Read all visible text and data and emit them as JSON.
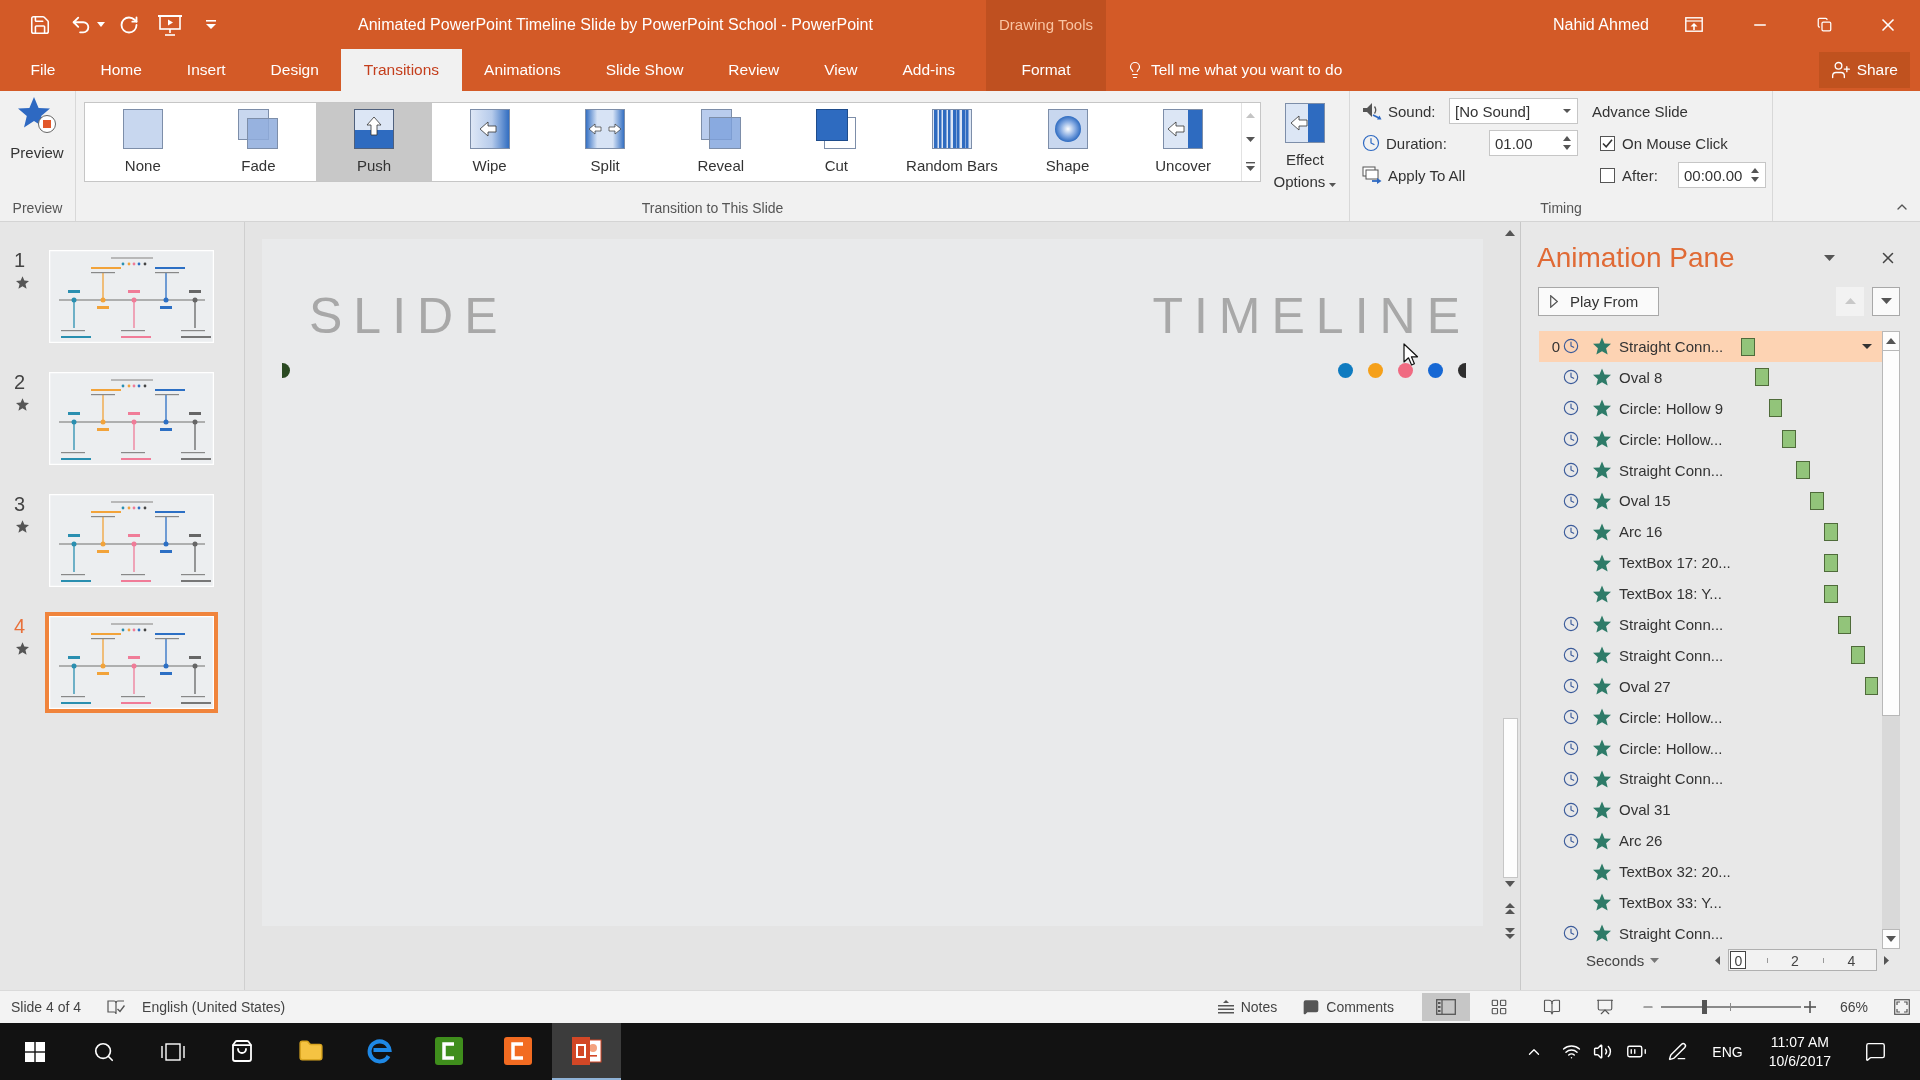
{
  "window": {
    "title": "Animated PowerPoint Timeline Slide by PowerPoint School - PowerPoint",
    "user_name": "Nahid Ahmed"
  },
  "ribbon_tabs": [
    {
      "label": "File",
      "selected": false
    },
    {
      "label": "Home",
      "selected": false
    },
    {
      "label": "Insert",
      "selected": false
    },
    {
      "label": "Design",
      "selected": false
    },
    {
      "label": "Transitions",
      "selected": true
    },
    {
      "label": "Animations",
      "selected": false
    },
    {
      "label": "Slide Show",
      "selected": false
    },
    {
      "label": "Review",
      "selected": false
    },
    {
      "label": "View",
      "selected": false
    },
    {
      "label": "Add-ins",
      "selected": false
    }
  ],
  "contextual_tabs": {
    "group": "Drawing Tools",
    "tabs": [
      {
        "label": "Format",
        "selected": false
      }
    ]
  },
  "tell_me": {
    "placeholder": "Tell me what you want to do"
  },
  "share_button": "Share",
  "ribbon": {
    "preview_group": {
      "button": "Preview",
      "label": "Preview"
    },
    "transition_group": {
      "label": "Transition to This Slide",
      "gallery": [
        {
          "kind": "none",
          "label": "None",
          "selected": false
        },
        {
          "kind": "fade",
          "label": "Fade",
          "selected": false
        },
        {
          "kind": "push",
          "label": "Push",
          "selected": true
        },
        {
          "kind": "wipe",
          "label": "Wipe",
          "selected": false
        },
        {
          "kind": "split",
          "label": "Split",
          "selected": false
        },
        {
          "kind": "reveal",
          "label": "Reveal",
          "selected": false
        },
        {
          "kind": "cut",
          "label": "Cut",
          "selected": false
        },
        {
          "kind": "random-bars",
          "label": "Random Bars",
          "selected": false
        },
        {
          "kind": "shape",
          "label": "Shape",
          "selected": false
        },
        {
          "kind": "uncover",
          "label": "Uncover",
          "selected": false
        }
      ],
      "effect_options": "Effect Options"
    },
    "timing_group": {
      "label": "Timing",
      "sound": {
        "label": "Sound:",
        "value": "[No Sound]"
      },
      "duration": {
        "label": "Duration:",
        "value": "01.00"
      },
      "apply_to_all": "Apply To All",
      "advance_slide": {
        "heading": "Advance Slide",
        "on_mouse_click": {
          "label": "On Mouse Click",
          "checked": true
        },
        "after": {
          "label": "After:",
          "checked": false,
          "value": "00:00.00"
        }
      }
    }
  },
  "slides": [
    {
      "number": "1",
      "selected": false
    },
    {
      "number": "2",
      "selected": false
    },
    {
      "number": "3",
      "selected": false
    },
    {
      "number": "4",
      "selected": true
    }
  ],
  "slide": {
    "title_parts": [
      "SLIDE",
      "TIMELINE"
    ],
    "dots_left": [
      {
        "color": "#2b4a22",
        "clipped": true
      }
    ],
    "dots_right": [
      {
        "color": "#0f7bc0",
        "clipped": false
      },
      {
        "color": "#f5a01a",
        "clipped": false
      },
      {
        "color": "#f06b82",
        "clipped": false
      },
      {
        "color": "#1768d4",
        "clipped": false
      },
      {
        "color": "#2e2e2e",
        "clipped": true
      }
    ]
  },
  "animation_pane": {
    "title": "Animation Pane",
    "play_button": "Play From",
    "items": [
      {
        "index": "0",
        "kind": "after-previous",
        "label": "Straight Conn...",
        "selected": true
      },
      {
        "kind": "after-previous",
        "label": "Oval 8",
        "selected": false
      },
      {
        "kind": "after-previous",
        "label": "Circle: Hollow 9",
        "selected": false
      },
      {
        "kind": "after-previous",
        "label": "Circle: Hollow...",
        "selected": false
      },
      {
        "kind": "after-previous",
        "label": "Straight Conn...",
        "selected": false
      },
      {
        "kind": "after-previous",
        "label": "Oval 15",
        "selected": false
      },
      {
        "kind": "after-previous",
        "label": "Arc 16",
        "selected": false
      },
      {
        "kind": "with-previous",
        "label": "TextBox 17: 20...",
        "selected": false
      },
      {
        "kind": "with-previous",
        "label": "TextBox 18: Y...",
        "selected": false
      },
      {
        "kind": "after-previous",
        "label": "Straight Conn...",
        "selected": false
      },
      {
        "kind": "after-previous",
        "label": "Straight Conn...",
        "selected": false
      },
      {
        "kind": "after-previous",
        "label": "Oval 27",
        "selected": false
      },
      {
        "kind": "after-previous",
        "label": "Circle: Hollow...",
        "selected": false
      },
      {
        "kind": "after-previous",
        "label": "Circle: Hollow...",
        "selected": false
      },
      {
        "kind": "after-previous",
        "label": "Straight Conn...",
        "selected": false
      },
      {
        "kind": "after-previous",
        "label": "Oval 31",
        "selected": false
      },
      {
        "kind": "after-previous",
        "label": "Arc 26",
        "selected": false
      },
      {
        "kind": "with-previous",
        "label": "TextBox 32: 20...",
        "selected": false
      },
      {
        "kind": "with-previous",
        "label": "TextBox 33: Y...",
        "selected": false
      },
      {
        "kind": "after-previous",
        "label": "Straight Conn...",
        "selected": false
      }
    ],
    "timeline": {
      "unit": "Seconds",
      "ticks": [
        {
          "label": "0",
          "selected": true
        },
        {
          "label": "2",
          "selected": false
        },
        {
          "label": "4",
          "selected": false
        }
      ]
    }
  },
  "status_bar": {
    "slide_info": "Slide 4 of 4",
    "language": "English (United States)",
    "notes": "Notes",
    "comments": "Comments",
    "views": [
      {
        "kind": "normal",
        "selected": true
      },
      {
        "kind": "slide-sorter",
        "selected": false
      },
      {
        "kind": "reading",
        "selected": false
      },
      {
        "kind": "slide-show",
        "selected": false
      }
    ],
    "zoom": {
      "level": 0.31,
      "reading": "66%"
    }
  },
  "taskbar": {
    "apps": [
      {
        "kind": "store",
        "selected": false
      },
      {
        "kind": "file-explorer",
        "selected": false
      },
      {
        "kind": "edge",
        "selected": false
      },
      {
        "kind": "camtasia-recorder",
        "selected": false
      },
      {
        "kind": "camtasia-studio",
        "selected": false
      },
      {
        "kind": "powerpoint",
        "selected": true
      }
    ],
    "language": "ENG",
    "time": "11:07 AM",
    "date": "10/6/2017"
  }
}
